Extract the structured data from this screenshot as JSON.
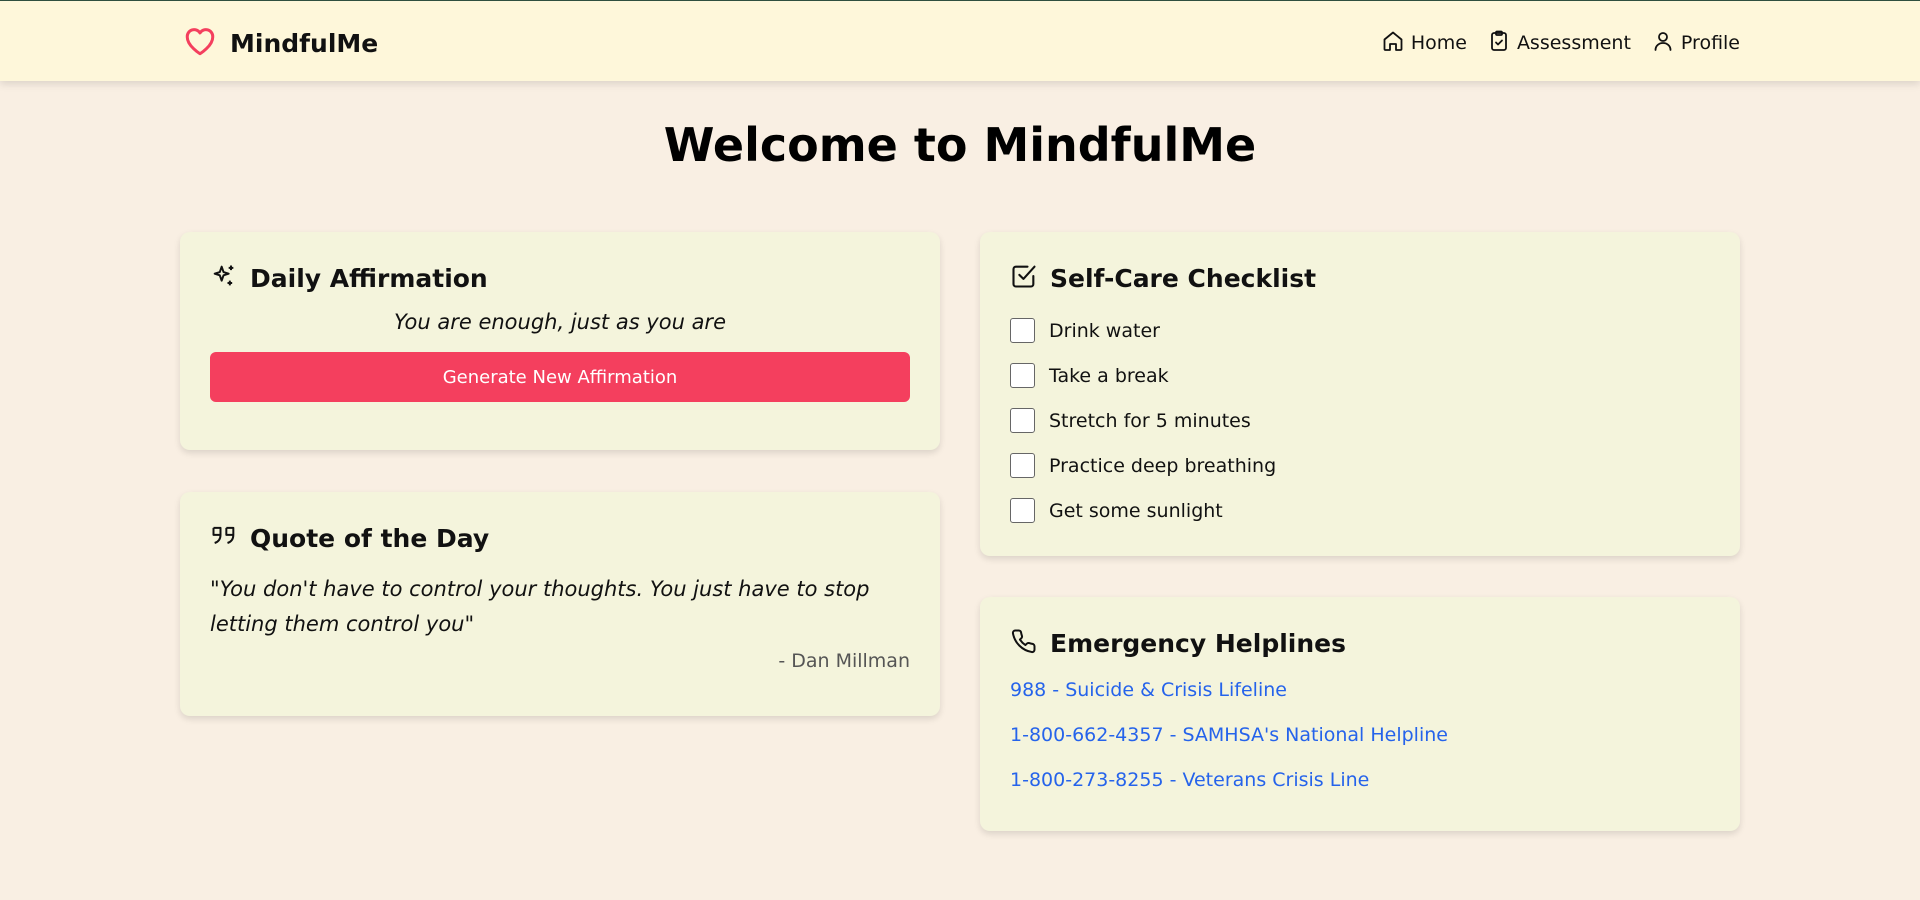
{
  "header": {
    "brand": "MindfulMe",
    "nav": [
      {
        "label": "Home",
        "icon": "home-icon"
      },
      {
        "label": "Assessment",
        "icon": "clipboard-check-icon"
      },
      {
        "label": "Profile",
        "icon": "user-icon"
      }
    ]
  },
  "main": {
    "title": "Welcome to MindfulMe",
    "affirmation": {
      "title": "Daily Affirmation",
      "icon": "sparkles-icon",
      "text": "You are enough, just as you are",
      "button_label": "Generate New Affirmation"
    },
    "quote": {
      "title": "Quote of the Day",
      "icon": "quote-icon",
      "text": "\"You don't have to control your thoughts. You just have to stop letting them control you\"",
      "author": "- Dan Millman"
    },
    "checklist": {
      "title": "Self-Care Checklist",
      "icon": "square-check-icon",
      "items": [
        {
          "label": "Drink water",
          "checked": false
        },
        {
          "label": "Take a break",
          "checked": false
        },
        {
          "label": "Stretch for 5 minutes",
          "checked": false
        },
        {
          "label": "Practice deep breathing",
          "checked": false
        },
        {
          "label": "Get some sunlight",
          "checked": false
        }
      ]
    },
    "helplines": {
      "title": "Emergency Helplines",
      "icon": "phone-icon",
      "items": [
        "988 - Suicide & Crisis Lifeline",
        "1-800-662-4357 - SAMHSA's National Helpline",
        "1-800-273-8255 - Veterans Crisis Line"
      ]
    }
  },
  "colors": {
    "background": "#f9efe3",
    "header": "#fef7da",
    "card": "#f4f4dc",
    "accent": "#f43f5e",
    "link": "#2563eb"
  }
}
